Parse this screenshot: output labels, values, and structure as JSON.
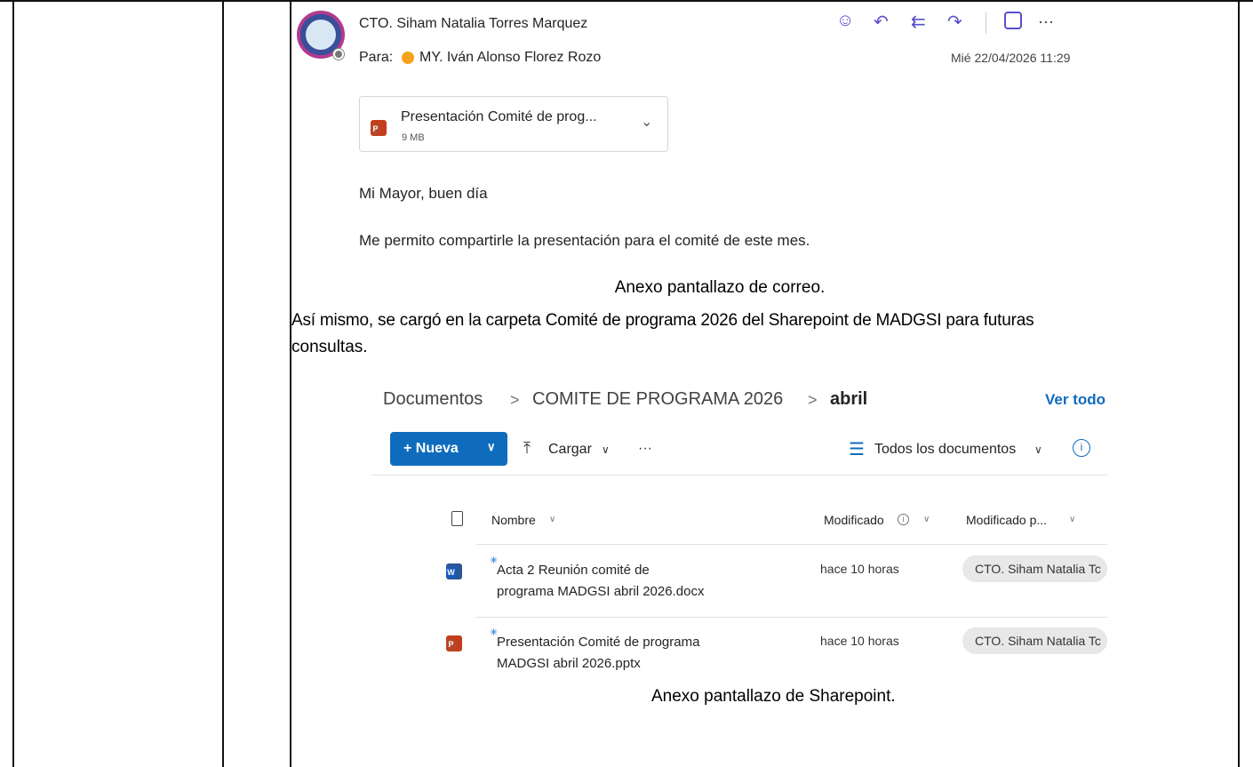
{
  "email": {
    "sender": "CTO. Siham Natalia Torres Marquez",
    "to_label": "Para:",
    "recipient": "MY. Iván Alonso Florez Rozo",
    "date": "Mié 22/04/2026 11:29",
    "attachment": {
      "name": "Presentación Comité de prog...",
      "size": "9 MB"
    },
    "greeting": "Mi Mayor, buen día",
    "body": "Me permito compartirle la presentación para el comité de este mes.",
    "more": "···"
  },
  "doc": {
    "caption_mail": "Anexo pantallazo de correo.",
    "paragraph_line1": "Así mismo, se cargó en la carpeta Comité de programa 2026 del Sharepoint de MADGSI para futuras",
    "paragraph_line2": "consultas.",
    "caption_sharepoint": "Anexo pantallazo de Sharepoint."
  },
  "sharepoint": {
    "breadcrumb": [
      "Documentos",
      "COMITE DE PROGRAMA 2026",
      "abril"
    ],
    "breadcrumb_sep": ">",
    "see_all": "Ver todo",
    "new_button": "+ Nueva",
    "upload": "Cargar",
    "more": "···",
    "view": "Todos los documentos",
    "columns": {
      "name": "Nombre",
      "modified": "Modificado",
      "modified_by": "Modificado p..."
    },
    "files": [
      {
        "name_line1": "Acta 2 Reunión comité de",
        "name_line2": "programa MADGSI abril 2026.docx",
        "modified": "hace 10 horas",
        "modified_by": "CTO. Siham Natalia Tc",
        "icon": "word-file-icon"
      },
      {
        "name_line1": "Presentación Comité de programa",
        "name_line2": "MADGSI abril 2026.pptx",
        "modified": "hace 10 horas",
        "modified_by": "CTO. Siham Natalia Tc",
        "icon": "powerpoint-file-icon"
      }
    ]
  },
  "colors": {
    "accent": "#0f6cbd",
    "toolbar_icon": "#5a4fcf",
    "presence": "#f7a21b"
  }
}
